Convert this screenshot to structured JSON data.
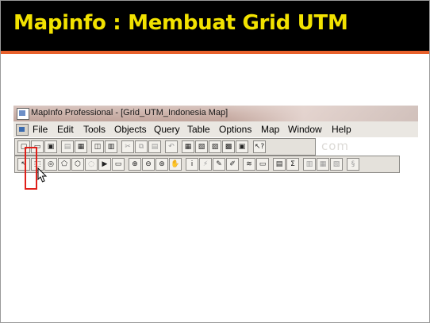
{
  "slide": {
    "title": "Mapinfo : Membuat Grid UTM",
    "colors": {
      "title_bg": "#000000",
      "title_text": "#f2e200",
      "accent": "#e8612c",
      "highlight": "#e0201a"
    }
  },
  "window": {
    "title": "MapInfo Professional - [Grid_UTM_Indonesia Map]"
  },
  "menu": {
    "items": [
      "File",
      "Edit",
      "Tools",
      "Objects",
      "Query",
      "Table",
      "Options",
      "Map",
      "Window",
      "Help"
    ]
  },
  "toolbar1": {
    "buttons": [
      {
        "name": "new-table-icon",
        "glyph": "▢"
      },
      {
        "name": "open-table-icon",
        "glyph": "▭"
      },
      {
        "name": "open-workspace-icon",
        "glyph": "▣"
      },
      {
        "name": "save-table-icon",
        "glyph": "▤",
        "disabled": true
      },
      {
        "name": "save-window-icon",
        "glyph": "▦"
      },
      {
        "name": "open-dbms-icon",
        "glyph": "◫"
      },
      {
        "name": "print-icon",
        "glyph": "▥"
      },
      {
        "name": "cut-icon",
        "glyph": "✂",
        "disabled": true
      },
      {
        "name": "copy-icon",
        "glyph": "⧉",
        "disabled": true
      },
      {
        "name": "paste-icon",
        "glyph": "▤",
        "disabled": true
      },
      {
        "name": "undo-icon",
        "glyph": "↶",
        "disabled": true
      },
      {
        "name": "new-browser-icon",
        "glyph": "▦"
      },
      {
        "name": "new-mapper-icon",
        "glyph": "▧"
      },
      {
        "name": "new-grapher-icon",
        "glyph": "▨"
      },
      {
        "name": "new-layout-icon",
        "glyph": "▩"
      },
      {
        "name": "new-redistrict-icon",
        "glyph": "▣"
      },
      {
        "name": "help-cursor-icon",
        "glyph": "↖?"
      }
    ]
  },
  "toolbar2": {
    "buttons": [
      {
        "name": "select-arrow-icon",
        "glyph": "↖"
      },
      {
        "name": "marquee-select-icon",
        "glyph": "⬚"
      },
      {
        "name": "radius-select-icon",
        "glyph": "◎"
      },
      {
        "name": "polygon-select-icon",
        "glyph": "⬠"
      },
      {
        "name": "boundary-select-icon",
        "glyph": "⬡"
      },
      {
        "name": "unselect-all-icon",
        "glyph": "◌",
        "disabled": true
      },
      {
        "name": "invert-selection-icon",
        "glyph": "▶"
      },
      {
        "name": "graph-select-icon",
        "glyph": "▭"
      },
      {
        "name": "zoom-in-icon",
        "glyph": "⊕"
      },
      {
        "name": "zoom-out-icon",
        "glyph": "⊖"
      },
      {
        "name": "change-view-icon",
        "glyph": "⊛"
      },
      {
        "name": "grabber-hand-icon",
        "glyph": "✋"
      },
      {
        "name": "info-tool-icon",
        "glyph": "i"
      },
      {
        "name": "hotlink-icon",
        "glyph": "⚡",
        "disabled": true
      },
      {
        "name": "label-tool-icon",
        "glyph": "✎"
      },
      {
        "name": "drag-window-icon",
        "glyph": "✐"
      },
      {
        "name": "layer-control-icon",
        "glyph": "≋"
      },
      {
        "name": "ruler-icon",
        "glyph": "▭"
      },
      {
        "name": "legend-icon",
        "glyph": "▤"
      },
      {
        "name": "statistics-icon",
        "glyph": "Σ"
      },
      {
        "name": "set-target-icon",
        "glyph": "▥",
        "disabled": true
      },
      {
        "name": "clip-region-icon",
        "glyph": "▦",
        "disabled": true
      },
      {
        "name": "show-legend-icon",
        "glyph": "▧",
        "disabled": true
      },
      {
        "name": "show-stats-icon",
        "glyph": "§",
        "disabled": true
      }
    ]
  }
}
